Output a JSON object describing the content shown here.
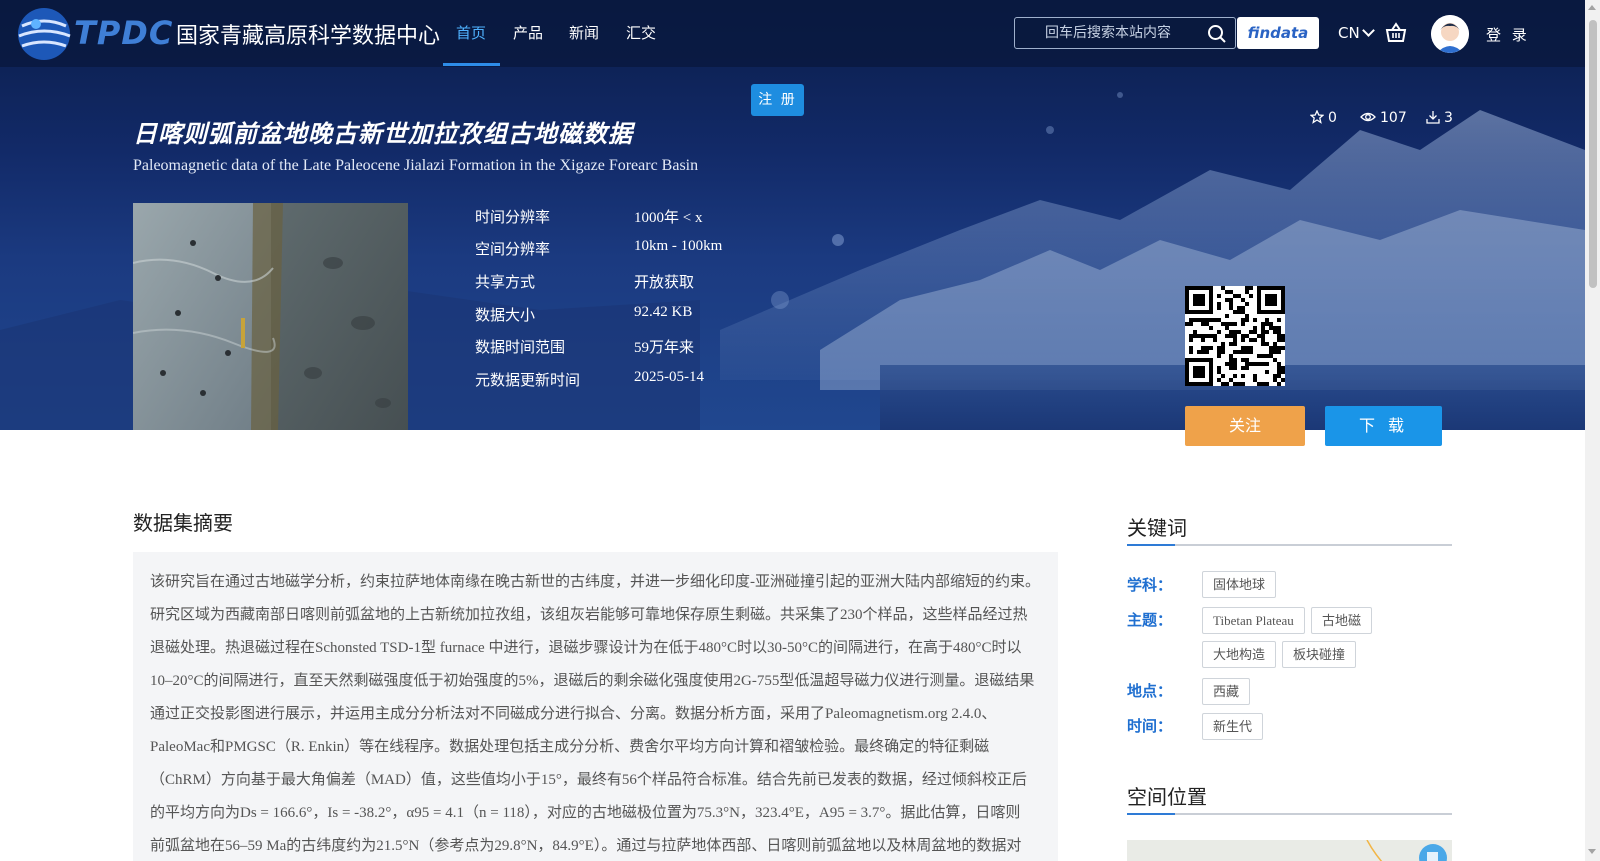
{
  "header": {
    "logo_abbr": "TPDC",
    "logo_name": "国家青藏高原科学数据中心",
    "nav": [
      {
        "label": "首页",
        "active": true
      },
      {
        "label": "产品",
        "active": false
      },
      {
        "label": "新闻",
        "active": false
      },
      {
        "label": "汇交",
        "active": false
      }
    ],
    "search_placeholder": "回车后搜索本站内容",
    "findata_label": "findata",
    "lang_label": "CN",
    "login_label": "登 录"
  },
  "hero": {
    "register_label": "注 册",
    "title_cn": "日喀则弧前盆地晚古新世加拉孜组古地磁数据",
    "title_en": "Paleomagnetic data of the Late Paleocene Jialazi Formation in the Xigaze Forearc Basin",
    "stats": {
      "stars": "0",
      "views": "107",
      "downloads": "3"
    },
    "meta": [
      {
        "label": "时间分辨率",
        "value": "1000年 < x"
      },
      {
        "label": "空间分辨率",
        "value": "10km - 100km"
      },
      {
        "label": "共享方式",
        "value": "开放获取"
      },
      {
        "label": "数据大小",
        "value": "92.42 KB"
      },
      {
        "label": "数据时间范围",
        "value": "59万年来"
      },
      {
        "label": "元数据更新时间",
        "value": "2025-05-14"
      }
    ],
    "follow_label": "关注",
    "download_label": "下 载"
  },
  "abstract": {
    "title": "数据集摘要",
    "lines": [
      "该研究旨在通过古地磁学分析，约束拉萨地体南缘在晚古新世的古纬度，并进一步细化印度-亚洲碰撞引起的亚洲大陆内部缩短的约束。",
      "研究区域为西藏南部日喀则前弧盆地的上古新统加拉孜组，该组灰岩能够可靠地保存原生剩磁。共采集了230个样品，这些样品经过热",
      "退磁处理。热退磁过程在Schonsted TSD-1型 furnace 中进行，退磁步骤设计为在低于480°C时以30-50°C的间隔进行，在高于480°C时以",
      "10–20°C的间隔进行，直至天然剩磁强度低于初始强度的5%，退磁后的剩余磁化强度使用2G-755型低温超导磁力仪进行测量。退磁结果",
      "通过正交投影图进行展示，并运用主成分分析法对不同磁成分进行拟合、分离。数据分析方面，采用了Paleomagnetism.org 2.4.0、",
      "PaleoMac和PMGSC（R. Enkin）等在线程序。数据处理包括主成分分析、费舍尔平均方向计算和褶皱检验。最终确定的特征剩磁",
      "（ChRM）方向基于最大角偏差（MAD）值，这些值均小于15°，最终有56个样品符合标准。结合先前已发表的数据，经过倾斜校正后",
      "的平均方向为Ds = 166.6°，Is = -38.2°，α95 = 4.1（n = 118），对应的古地磁极位置为75.3°N，323.4°E，A95 = 3.7°。据此估算，日喀则",
      "前弧盆地在56–59 Ma的古纬度约为21.5°N（参考点为29.8°N，84.9°E）。通过与拉萨地体西部、日喀则前弧盆地以及林周盆地的数据对"
    ]
  },
  "keywords": {
    "title": "关键词",
    "groups": [
      {
        "label": "学科：",
        "tags": [
          "固体地球"
        ]
      },
      {
        "label": "主题：",
        "tags": [
          "Tibetan Plateau",
          "古地磁",
          "大地构造",
          "板块碰撞"
        ]
      },
      {
        "label": "地点：",
        "tags": [
          "西藏"
        ]
      },
      {
        "label": "时间：",
        "tags": [
          "新生代"
        ]
      }
    ]
  },
  "location": {
    "title": "空间位置"
  },
  "colors": {
    "accent_blue": "#1a95e8",
    "follow_orange": "#efa24a",
    "keyword_label": "#1f6fd0"
  }
}
